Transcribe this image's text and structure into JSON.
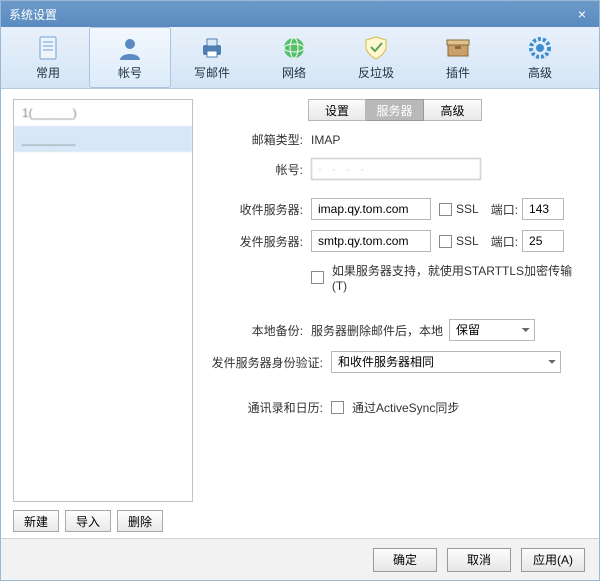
{
  "window": {
    "title": "系统设置"
  },
  "toolbar": {
    "items": [
      {
        "label": "常用"
      },
      {
        "label": "帐号"
      },
      {
        "label": "写邮件"
      },
      {
        "label": "网络"
      },
      {
        "label": "反垃圾"
      },
      {
        "label": "插件"
      },
      {
        "label": "高级"
      }
    ]
  },
  "accounts": {
    "rows": [
      {
        "label": "1(______)"
      },
      {
        "label": "________"
      }
    ],
    "buttons": {
      "new": "新建",
      "import": "导入",
      "delete": "删除"
    }
  },
  "tabs": {
    "settings": "设置",
    "server": "服务器",
    "advanced": "高级"
  },
  "form": {
    "mailbox_type_label": "邮箱类型:",
    "mailbox_type_value": "IMAP",
    "account_label": "帐号:",
    "account_value": "·   ·   ·   ·",
    "incoming_label": "收件服务器:",
    "incoming_value": "imap.qy.tom.com",
    "ssl_label": "SSL",
    "port_label": "端口:",
    "incoming_port": "143",
    "outgoing_label": "发件服务器:",
    "outgoing_value": "smtp.qy.tom.com",
    "outgoing_port": "25",
    "starttls_label": "如果服务器支持，就使用STARTTLS加密传输(T)",
    "local_backup_label": "本地备份:",
    "local_backup_prefix": "服务器删除邮件后，本地",
    "local_backup_select": "保留",
    "smtp_auth_label": "发件服务器身份验证:",
    "smtp_auth_select": "和收件服务器相同",
    "contacts_label": "通讯录和日历:",
    "activesync_label": "通过ActiveSync同步"
  },
  "footer": {
    "ok": "确定",
    "cancel": "取消",
    "apply": "应用(A)"
  }
}
